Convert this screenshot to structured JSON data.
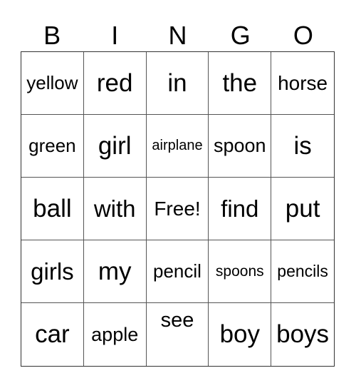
{
  "header": [
    "B",
    "I",
    "N",
    "G",
    "O"
  ],
  "cells": [
    {
      "text": "yellow",
      "size": 26
    },
    {
      "text": "red",
      "size": 35
    },
    {
      "text": "in",
      "size": 35
    },
    {
      "text": "the",
      "size": 35
    },
    {
      "text": "horse",
      "size": 28
    },
    {
      "text": "green",
      "size": 26
    },
    {
      "text": "girl",
      "size": 35
    },
    {
      "text": "airplane",
      "size": 20
    },
    {
      "text": "spoon",
      "size": 27
    },
    {
      "text": "is",
      "size": 35
    },
    {
      "text": "ball",
      "size": 35
    },
    {
      "text": "with",
      "size": 33
    },
    {
      "text": "Free!",
      "size": 28
    },
    {
      "text": "find",
      "size": 33
    },
    {
      "text": "put",
      "size": 35
    },
    {
      "text": "girls",
      "size": 33
    },
    {
      "text": "my",
      "size": 35
    },
    {
      "text": "pencil",
      "size": 26
    },
    {
      "text": "spoons",
      "size": 21
    },
    {
      "text": "pencils",
      "size": 23
    },
    {
      "text": "car",
      "size": 35
    },
    {
      "text": "apple",
      "size": 27
    },
    {
      "text": "see",
      "size": 29,
      "top": true
    },
    {
      "text": "boy",
      "size": 35
    },
    {
      "text": "boys",
      "size": 35
    }
  ]
}
